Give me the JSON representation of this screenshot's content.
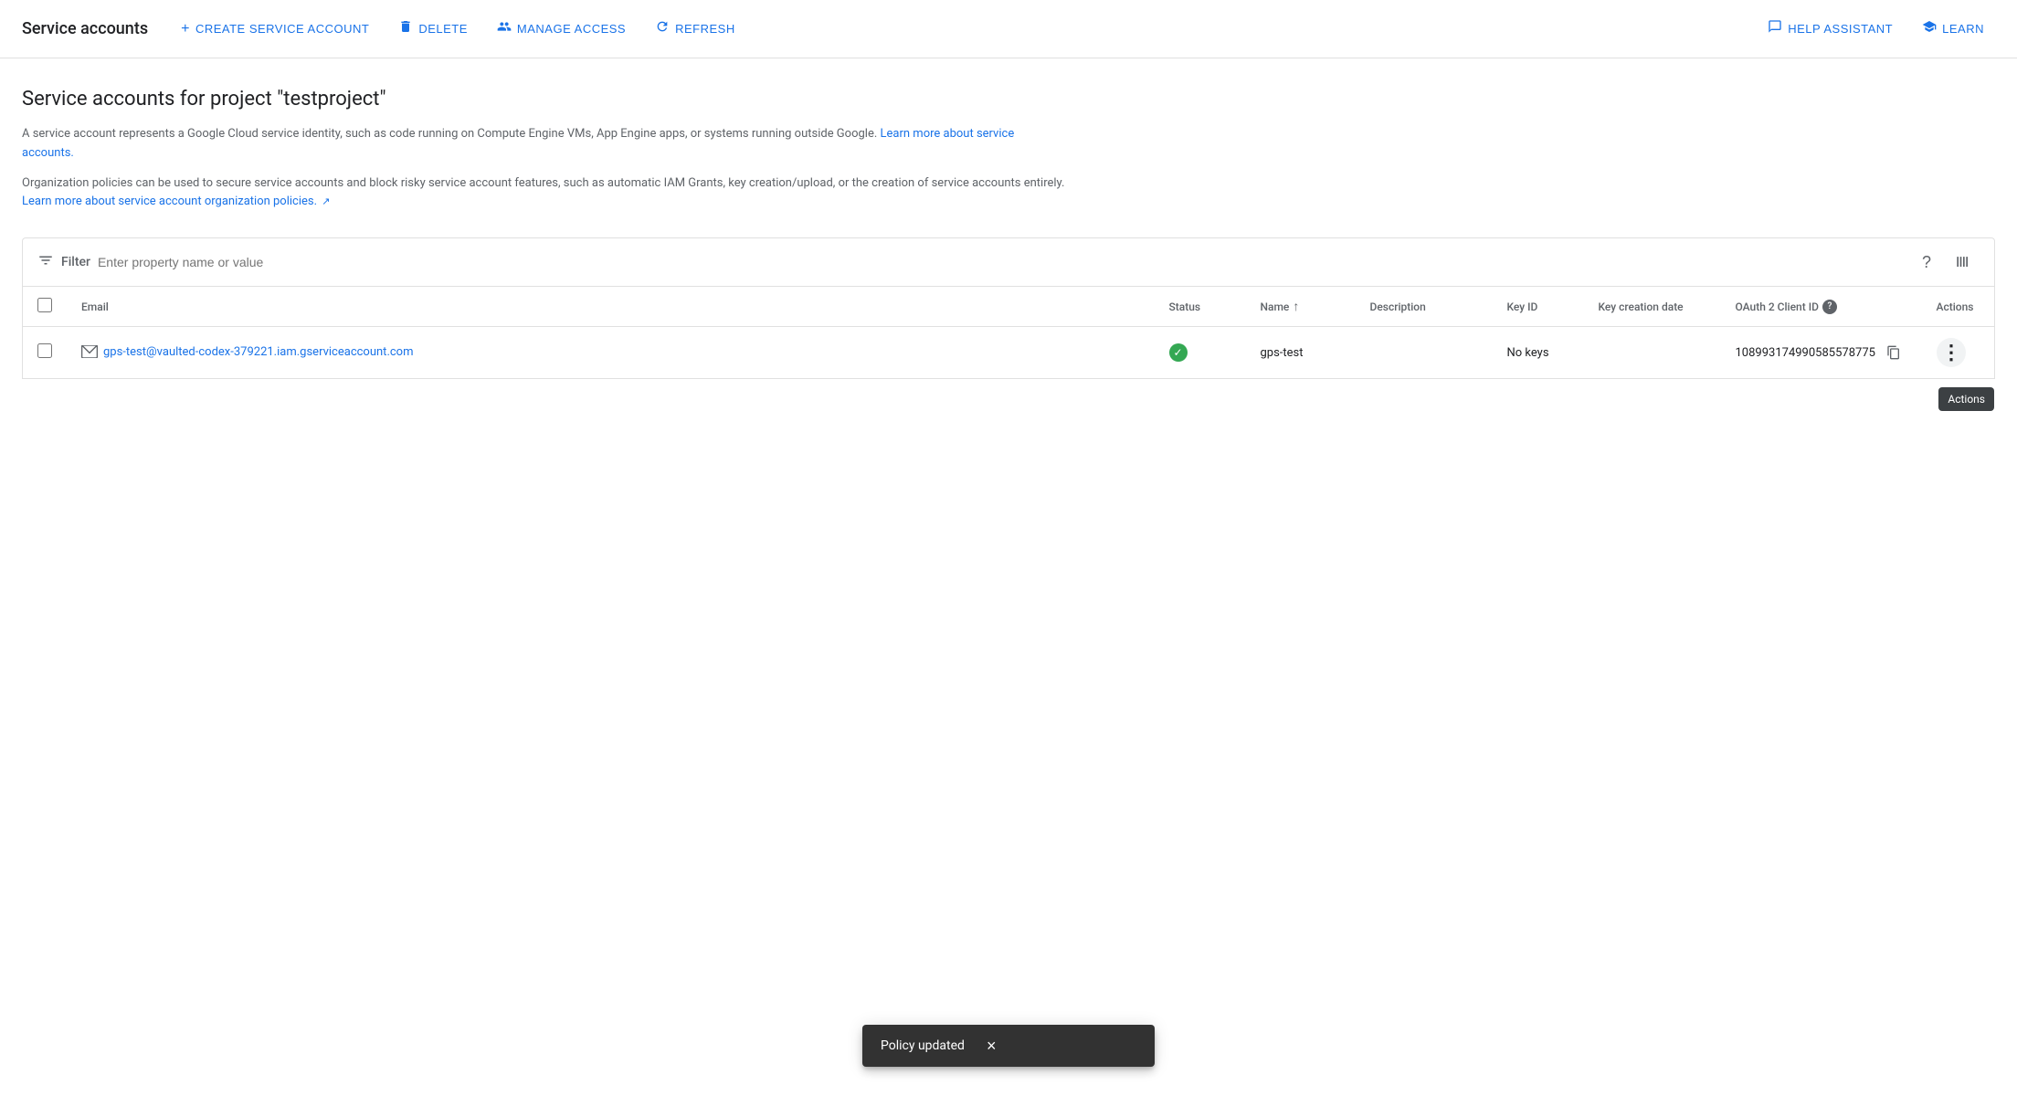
{
  "toolbar": {
    "title": "Service accounts",
    "buttons": [
      {
        "id": "create",
        "icon": "+",
        "label": "CREATE SERVICE ACCOUNT"
      },
      {
        "id": "delete",
        "icon": "🗑",
        "label": "DELETE"
      },
      {
        "id": "manage-access",
        "icon": "👤+",
        "label": "MANAGE ACCESS"
      },
      {
        "id": "refresh",
        "icon": "↻",
        "label": "REFRESH"
      },
      {
        "id": "help-assistant",
        "icon": "💬",
        "label": "HELP ASSISTANT"
      },
      {
        "id": "learn",
        "icon": "🎓",
        "label": "LEARN"
      }
    ]
  },
  "page": {
    "heading": "Service accounts for project \"testproject\"",
    "description": "A service account represents a Google Cloud service identity, such as code running on Compute Engine VMs, App Engine apps, or systems running outside Google.",
    "description_link": "Learn more about service accounts.",
    "org_policy": "Organization policies can be used to secure service accounts and block risky service account features, such as automatic IAM Grants, key creation/upload, or the creation of service accounts entirely.",
    "org_policy_link": "Learn more about service account organization policies."
  },
  "filter": {
    "label": "Filter",
    "placeholder": "Enter property name or value"
  },
  "table": {
    "columns": [
      {
        "id": "email",
        "label": "Email",
        "sortable": false
      },
      {
        "id": "status",
        "label": "Status",
        "sortable": false
      },
      {
        "id": "name",
        "label": "Name",
        "sortable": true,
        "sort_dir": "asc"
      },
      {
        "id": "description",
        "label": "Description",
        "sortable": false
      },
      {
        "id": "key_id",
        "label": "Key ID",
        "sortable": false
      },
      {
        "id": "key_creation_date",
        "label": "Key creation date",
        "sortable": false
      },
      {
        "id": "oauth2_client_id",
        "label": "OAuth 2 Client ID",
        "has_help": true
      },
      {
        "id": "actions",
        "label": "Actions"
      }
    ],
    "rows": [
      {
        "email": "gps-test@vaulted-codex-379221.iam.gserviceaccount.com",
        "status": "active",
        "name": "gps-test",
        "description": "",
        "key_id": "No keys",
        "key_creation_date": "",
        "oauth2_client_id": "108993174990585578775"
      }
    ]
  },
  "snackbar": {
    "message": "Policy updated",
    "close_label": "×"
  },
  "tooltip": {
    "actions_label": "Actions"
  },
  "icons": {
    "filter": "≡",
    "question": "?",
    "columns": "⊞",
    "checkmark": "✓",
    "copy": "⧉",
    "three_dot": "⋮",
    "external_link": "↗",
    "email_icon": "📋"
  }
}
